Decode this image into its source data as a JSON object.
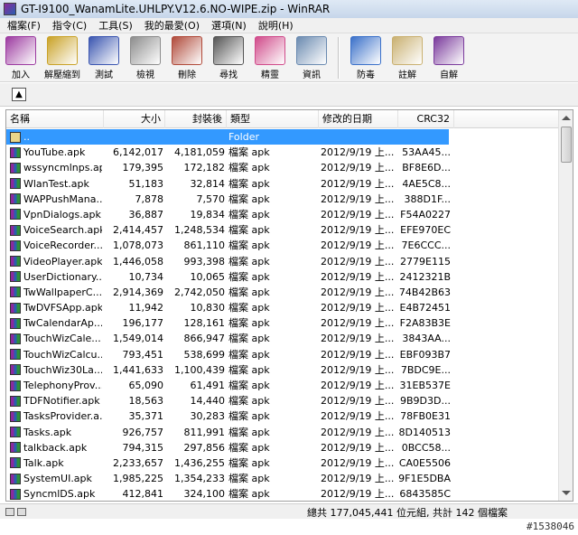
{
  "window": {
    "title": "GT-I9100_WanamLite.UHLPY.V12.6.NO-WIPE.zip - WinRAR"
  },
  "menu": [
    "檔案(F)",
    "指令(C)",
    "工具(S)",
    "我的最愛(O)",
    "選項(N)",
    "說明(H)"
  ],
  "toolbar": [
    {
      "label": "加入",
      "icon": "add-archive-icon",
      "color": "#9c3aa0"
    },
    {
      "label": "解壓縮到",
      "icon": "extract-to-icon",
      "color": "#c9a227"
    },
    {
      "label": "測試",
      "icon": "test-icon",
      "color": "#3a55b0"
    },
    {
      "label": "檢視",
      "icon": "view-icon",
      "color": "#8c8c8c"
    },
    {
      "label": "刪除",
      "icon": "delete-icon",
      "color": "#b04a3a"
    },
    {
      "label": "尋找",
      "icon": "find-icon",
      "color": "#555555"
    },
    {
      "label": "精靈",
      "icon": "wizard-icon",
      "color": "#d04a8a"
    },
    {
      "label": "資訊",
      "icon": "info-icon",
      "color": "#6a8ab0"
    },
    {
      "label": "防毒",
      "icon": "virus-scan-icon",
      "color": "#3a70c9"
    },
    {
      "label": "註解",
      "icon": "comment-icon",
      "color": "#c9b070"
    },
    {
      "label": "自解",
      "icon": "sfx-icon",
      "color": "#7a3a9c"
    }
  ],
  "columns": {
    "name": "名稱",
    "size": "大小",
    "packed": "封裝後",
    "type": "類型",
    "modified": "修改的日期",
    "crc": "CRC32"
  },
  "parent_row": {
    "name": "..",
    "type": "Folder"
  },
  "files": [
    {
      "name": "YouTube.apk",
      "size": "6,142,017",
      "packed": "4,181,059",
      "type": "檔案 apk",
      "modified": "2012/9/19 上...",
      "crc": "53AA45..."
    },
    {
      "name": "wssyncmlnps.apk",
      "size": "179,395",
      "packed": "172,182",
      "type": "檔案 apk",
      "modified": "2012/9/19 上...",
      "crc": "BF8E6D..."
    },
    {
      "name": "WlanTest.apk",
      "size": "51,183",
      "packed": "32,814",
      "type": "檔案 apk",
      "modified": "2012/9/19 上...",
      "crc": "4AE5C8..."
    },
    {
      "name": "WAPPushMana...",
      "size": "7,878",
      "packed": "7,570",
      "type": "檔案 apk",
      "modified": "2012/9/19 上...",
      "crc": "388D1F..."
    },
    {
      "name": "VpnDialogs.apk",
      "size": "36,887",
      "packed": "19,834",
      "type": "檔案 apk",
      "modified": "2012/9/19 上...",
      "crc": "F54A0227"
    },
    {
      "name": "VoiceSearch.apk",
      "size": "2,414,457",
      "packed": "1,248,534",
      "type": "檔案 apk",
      "modified": "2012/9/19 上...",
      "crc": "EFE970EC"
    },
    {
      "name": "VoiceRecorder....",
      "size": "1,078,073",
      "packed": "861,110",
      "type": "檔案 apk",
      "modified": "2012/9/19 上...",
      "crc": "7E6CCC..."
    },
    {
      "name": "VideoPlayer.apk",
      "size": "1,446,058",
      "packed": "993,398",
      "type": "檔案 apk",
      "modified": "2012/9/19 上...",
      "crc": "2779E115"
    },
    {
      "name": "UserDictionary....",
      "size": "10,734",
      "packed": "10,065",
      "type": "檔案 apk",
      "modified": "2012/9/19 上...",
      "crc": "2412321B"
    },
    {
      "name": "TwWallpaperC...",
      "size": "2,914,369",
      "packed": "2,742,050",
      "type": "檔案 apk",
      "modified": "2012/9/19 上...",
      "crc": "74B42B63"
    },
    {
      "name": "TwDVFSApp.apk",
      "size": "11,942",
      "packed": "10,830",
      "type": "檔案 apk",
      "modified": "2012/9/19 上...",
      "crc": "E4B72451"
    },
    {
      "name": "TwCalendarAp...",
      "size": "196,177",
      "packed": "128,161",
      "type": "檔案 apk",
      "modified": "2012/9/19 上...",
      "crc": "F2A83B3E"
    },
    {
      "name": "TouchWizCale...",
      "size": "1,549,014",
      "packed": "866,947",
      "type": "檔案 apk",
      "modified": "2012/9/19 上...",
      "crc": "3843AA..."
    },
    {
      "name": "TouchWizCalcu...",
      "size": "793,451",
      "packed": "538,699",
      "type": "檔案 apk",
      "modified": "2012/9/19 上...",
      "crc": "EBF093B7"
    },
    {
      "name": "TouchWiz30La...",
      "size": "1,441,633",
      "packed": "1,100,439",
      "type": "檔案 apk",
      "modified": "2012/9/19 上...",
      "crc": "7BDC9E..."
    },
    {
      "name": "TelephonyProv...",
      "size": "65,090",
      "packed": "61,491",
      "type": "檔案 apk",
      "modified": "2012/9/19 上...",
      "crc": "31EB537E"
    },
    {
      "name": "TDFNotifier.apk",
      "size": "18,563",
      "packed": "14,440",
      "type": "檔案 apk",
      "modified": "2012/9/19 上...",
      "crc": "9B9D3D..."
    },
    {
      "name": "TasksProvider.a...",
      "size": "35,371",
      "packed": "30,283",
      "type": "檔案 apk",
      "modified": "2012/9/19 上...",
      "crc": "78FB0E31"
    },
    {
      "name": "Tasks.apk",
      "size": "926,757",
      "packed": "811,991",
      "type": "檔案 apk",
      "modified": "2012/9/19 上...",
      "crc": "8D140513"
    },
    {
      "name": "talkback.apk",
      "size": "794,315",
      "packed": "297,856",
      "type": "檔案 apk",
      "modified": "2012/9/19 上...",
      "crc": "0BCC58..."
    },
    {
      "name": "Talk.apk",
      "size": "2,233,657",
      "packed": "1,436,255",
      "type": "檔案 apk",
      "modified": "2012/9/19 上...",
      "crc": "CA0E5506"
    },
    {
      "name": "SystemUI.apk",
      "size": "1,985,225",
      "packed": "1,354,233",
      "type": "檔案 apk",
      "modified": "2012/9/19 上...",
      "crc": "9F1E5DBA"
    },
    {
      "name": "SyncmlDS.apk",
      "size": "412,841",
      "packed": "324,100",
      "type": "檔案 apk",
      "modified": "2012/9/19 上...",
      "crc": "6843585C"
    }
  ],
  "status": {
    "text": "總共 177,045,441 位元組, 共計 142 個檔案"
  },
  "watermark": "#1538046"
}
